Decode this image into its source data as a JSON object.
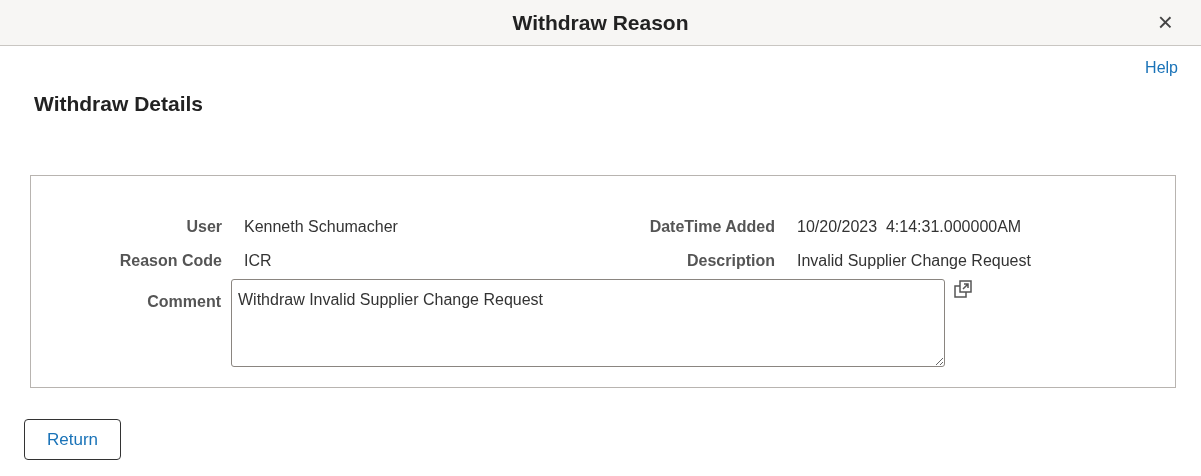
{
  "window": {
    "title": "Withdraw Reason",
    "close": "×"
  },
  "help_link": "Help",
  "section_title": "Withdraw Details",
  "fields": [
    {
      "label": "User",
      "value": "Kenneth Schumacher"
    },
    {
      "label": "DateTime Added",
      "value": "10/20/2023  4:14:31.000000AM"
    },
    {
      "label": "Reason Code",
      "value": "ICR"
    },
    {
      "label": "Description",
      "value": "Invalid Supplier Change Request"
    }
  ],
  "comment": {
    "label": "Comment",
    "value": "Withdraw Invalid Supplier Change Request"
  },
  "buttons": [
    {
      "label": "Return"
    }
  ]
}
